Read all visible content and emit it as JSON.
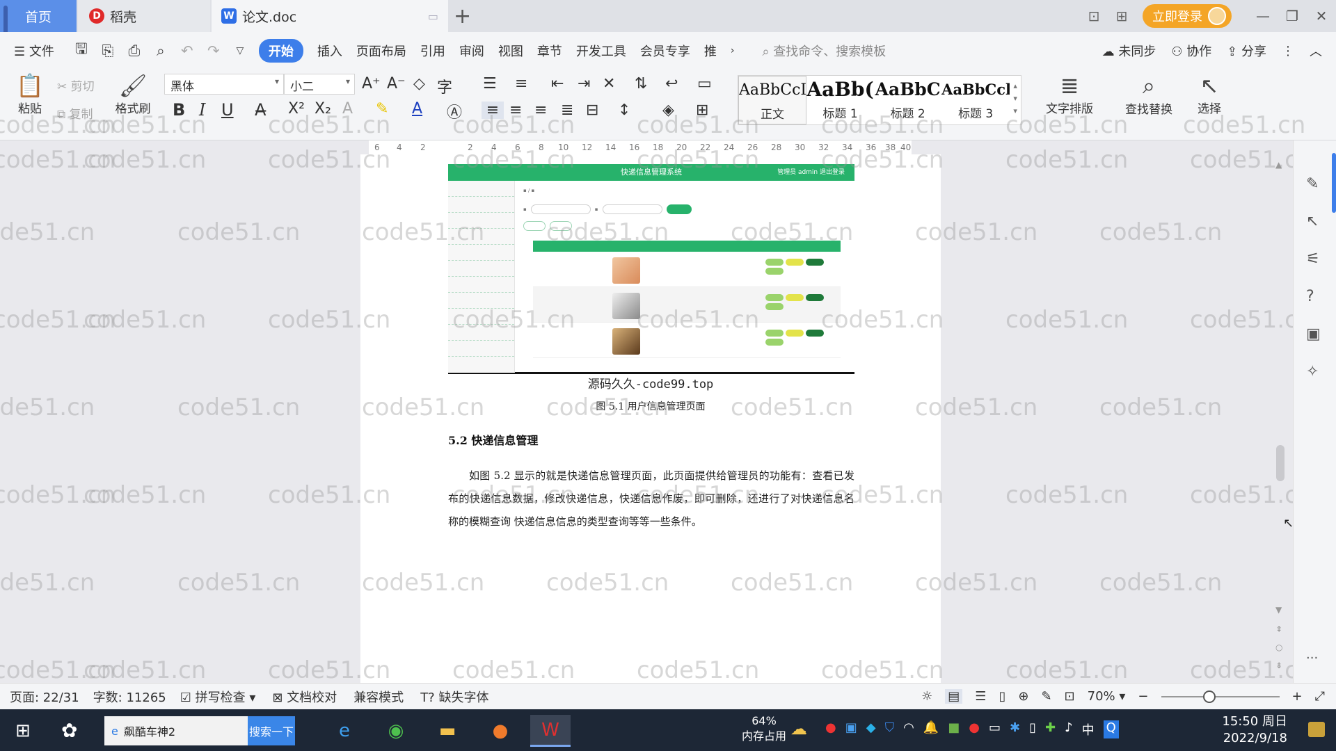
{
  "tabs": {
    "home": "首页",
    "daoke": "稻壳",
    "doc": "论文.doc"
  },
  "titlebar": {
    "login": "立即登录"
  },
  "menu": {
    "file": "文件",
    "items": [
      "开始",
      "插入",
      "页面布局",
      "引用",
      "审阅",
      "视图",
      "章节",
      "开发工具",
      "会员专享",
      "推"
    ],
    "search_cmd": "查找命令、搜索模板",
    "unsynced": "未同步",
    "collab": "协作",
    "share": "分享"
  },
  "ribbon": {
    "paste": "粘贴",
    "cut": "剪切",
    "copy": "复制",
    "format_painter": "格式刷",
    "font": "黑体",
    "font_size": "小二",
    "styles": [
      {
        "preview": "AaBbCcI",
        "label": "正文"
      },
      {
        "preview": "AaBb(",
        "label": "标题 1"
      },
      {
        "preview": "AaBbC",
        "label": "标题 2"
      },
      {
        "preview": "AaBbCcl",
        "label": "标题 3"
      }
    ],
    "text_layout": "文字排版",
    "find_replace": "查找替换",
    "select": "选择"
  },
  "ruler": [
    "6",
    "4",
    "2",
    "2",
    "4",
    "6",
    "8",
    "10",
    "12",
    "14",
    "16",
    "18",
    "20",
    "22",
    "24",
    "26",
    "28",
    "30",
    "32",
    "34",
    "36",
    "38",
    "40"
  ],
  "document": {
    "screenshot": {
      "header": "快递信息管理系统",
      "user_info": "管理员 admin  退出登录"
    },
    "watermark_caption": "源码久久-code99.top",
    "figure_caption": "图 5.1  用户信息管理页面",
    "section_title": "5.2  快递信息管理",
    "paragraph": "如图 5.2 显示的就是快递信息管理页面，此页面提供给管理员的功能有：查看已发布的快递信息数据，修改快递信息，快递信息作废，即可删除，还进行了对快递信息名称的模糊查询 快递信息信息的类型查询等等一些条件。"
  },
  "watermark": "code51.cn",
  "status": {
    "page": "页面: 22/31",
    "words": "字数: 11265",
    "spell": "拼写检查",
    "proof": "文档校对",
    "compat": "兼容模式",
    "missing_font": "缺失字体",
    "zoom": "70%"
  },
  "taskbar": {
    "search_text": "飙酷车神2",
    "search_btn": "搜索一下",
    "mem_pct": "64%",
    "mem_label": "内存占用",
    "ime": "中",
    "time": "15:50 周日",
    "date": "2022/9/18"
  }
}
